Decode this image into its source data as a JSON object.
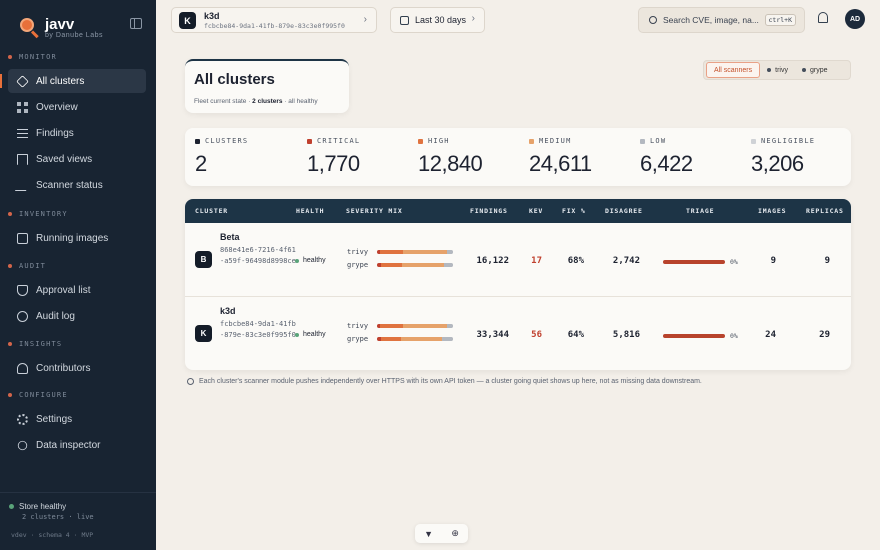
{
  "app": {
    "name": "javv",
    "byline": "by Danube Labs"
  },
  "sidebar": {
    "sections": [
      {
        "label": "MONITOR",
        "items": [
          {
            "label": "All clusters",
            "icon": "layers-icon",
            "active": true
          },
          {
            "label": "Overview",
            "icon": "grid-icon"
          },
          {
            "label": "Findings",
            "icon": "list-icon"
          },
          {
            "label": "Saved views",
            "icon": "bookmark-icon"
          },
          {
            "label": "Scanner status",
            "icon": "pulse-icon"
          }
        ]
      },
      {
        "label": "INVENTORY",
        "items": [
          {
            "label": "Running images",
            "icon": "box-icon"
          }
        ]
      },
      {
        "label": "AUDIT",
        "items": [
          {
            "label": "Approval list",
            "icon": "shield-icon"
          },
          {
            "label": "Audit log",
            "icon": "clock-icon"
          }
        ]
      },
      {
        "label": "INSIGHTS",
        "items": [
          {
            "label": "Contributors",
            "icon": "person-icon"
          }
        ]
      },
      {
        "label": "CONFIGURE",
        "items": [
          {
            "label": "Settings",
            "icon": "gear-icon"
          },
          {
            "label": "Data inspector",
            "icon": "search-icon"
          }
        ]
      }
    ],
    "status": {
      "label": "Store healthy",
      "sub": "2 clusters · live"
    },
    "version": "vdev · schema 4 · MVP"
  },
  "topbar": {
    "context": {
      "badge": "K",
      "name": "k3d",
      "id": "fcbcbe84-9da1-41fb-879e-83c3e0f995f0"
    },
    "date_range": "Last 30 days",
    "search": {
      "placeholder": "Search CVE, image, na...",
      "shortcut": "ctrl+K"
    },
    "avatar": "AD"
  },
  "page": {
    "title": "All clusters",
    "subtitle_pre": "Fleet current state · ",
    "subtitle_count": "2 clusters",
    "subtitle_post": " · all healthy"
  },
  "scanner_filter": [
    "All scanners",
    "trivy",
    "grype"
  ],
  "stats": [
    {
      "label": "CLUSTERS",
      "value": "2",
      "color": "#1d2230"
    },
    {
      "label": "CRITICAL",
      "value": "1,770",
      "color": "#c0402e"
    },
    {
      "label": "HIGH",
      "value": "12,840",
      "color": "#e0733f"
    },
    {
      "label": "MEDIUM",
      "value": "24,611",
      "color": "#e6a26a"
    },
    {
      "label": "LOW",
      "value": "6,422",
      "color": "#b3b8c0"
    },
    {
      "label": "NEGLIGIBLE",
      "value": "3,206",
      "color": "#cfd2d6"
    }
  ],
  "table": {
    "headers": [
      "CLUSTER",
      "HEALTH",
      "SEVERITY MIX",
      "FINDINGS",
      "KEV",
      "FIX %",
      "DISAGREE",
      "TRIAGE",
      "IMAGES",
      "REPLICAS"
    ],
    "rows": [
      {
        "badge": "B",
        "name": "Beta",
        "uuid": "868e41e6-7216-4f61-a59f-96498d8998ce",
        "health": "healthy",
        "mix": [
          {
            "scanner": "trivy",
            "parts": [
              4,
              30,
              58,
              8
            ]
          },
          {
            "scanner": "grype",
            "parts": [
              5,
              28,
              55,
              12
            ]
          }
        ],
        "findings": "16,122",
        "kev": "17",
        "fix": "68%",
        "disagree": "2,742",
        "triage_pct": "0%",
        "images": "9",
        "replicas": "9"
      },
      {
        "badge": "K",
        "name": "k3d",
        "uuid": "fcbcbe84-9da1-41fb-879e-83c3e0f995f0",
        "health": "healthy",
        "mix": [
          {
            "scanner": "trivy",
            "parts": [
              4,
              30,
              58,
              8
            ]
          },
          {
            "scanner": "grype",
            "parts": [
              5,
              26,
              55,
              14
            ]
          }
        ],
        "findings": "33,344",
        "kev": "56",
        "fix": "64%",
        "disagree": "5,816",
        "triage_pct": "0%",
        "images": "24",
        "replicas": "29"
      }
    ]
  },
  "note": "Each cluster's scanner module pushes independently over HTTPS with its own API token — a cluster going quiet shows up here, not as missing data downstream."
}
